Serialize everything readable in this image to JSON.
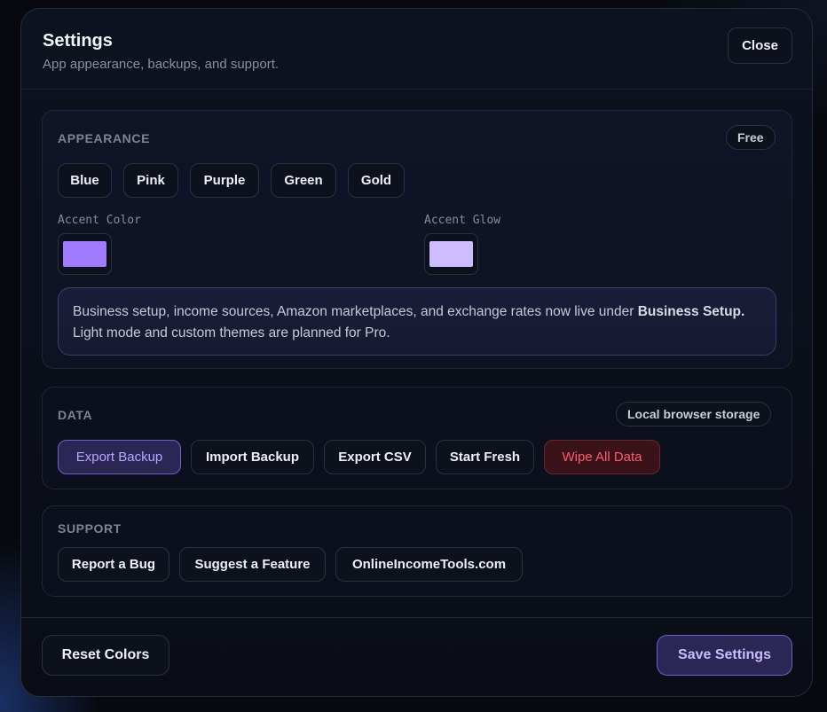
{
  "header": {
    "title": "Settings",
    "subtitle": "App appearance, backups, and support.",
    "close_label": "Close"
  },
  "appearance": {
    "section_label": "APPEARANCE",
    "plan_badge": "Free",
    "presets": [
      "Blue",
      "Pink",
      "Purple",
      "Green",
      "Gold"
    ],
    "accent_color_label": "Accent Color",
    "accent_color_value": "#9f7bff",
    "accent_glow_label": "Accent Glow",
    "accent_glow_value": "#cdbdff",
    "note_part1": "Business setup, income sources, Amazon marketplaces, and exchange rates now live under ",
    "note_bold": "Business Setup.",
    "note_part2": " Light mode and custom themes are planned for Pro."
  },
  "data": {
    "section_label": "DATA",
    "storage_badge": "Local browser storage",
    "buttons": [
      "Export Backup",
      "Import Backup",
      "Export CSV",
      "Start Fresh",
      "Wipe All Data"
    ]
  },
  "support": {
    "section_label": "SUPPORT",
    "links": [
      "Report a Bug",
      "Suggest a Feature",
      "OnlineIncomeTools.com"
    ]
  },
  "footer": {
    "reset_label": "Reset Colors",
    "save_label": "Save Settings"
  },
  "colors": {
    "accent": "#9f7bff",
    "danger": "#ff5a6e"
  }
}
